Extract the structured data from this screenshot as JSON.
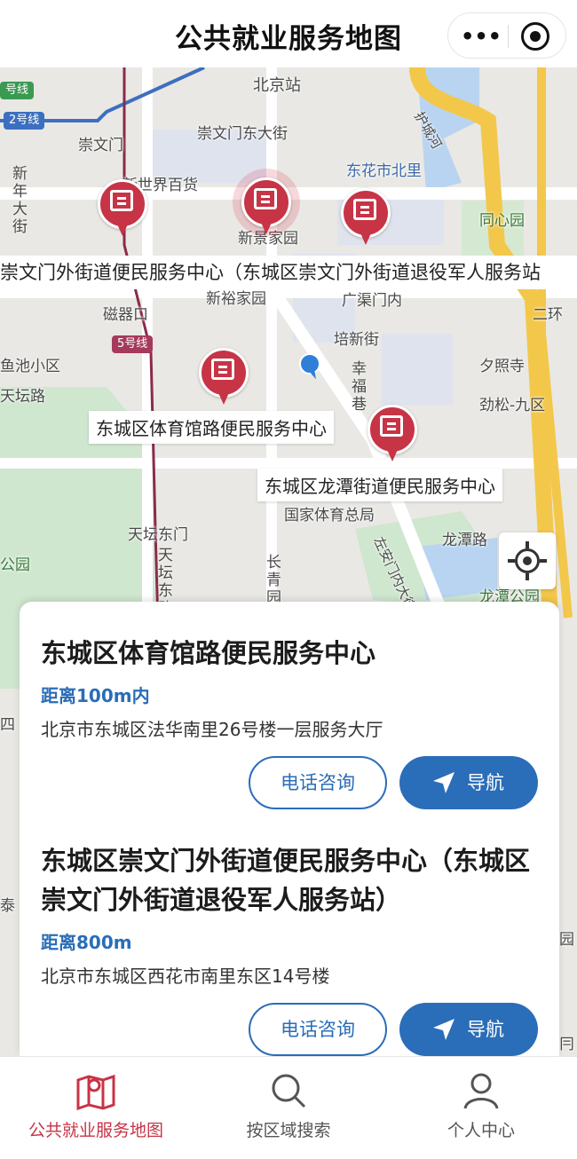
{
  "header": {
    "title": "公共就业服务地图",
    "more_icon": "•••"
  },
  "map": {
    "labels": {
      "beijing_station": "北京站",
      "chongwenmen": "崇文门",
      "chongwenmen_east_st": "崇文门东大街",
      "new_world": "新世界百货",
      "donghuashi_n": "东花市北里",
      "hucheng_river": "护城河",
      "tongxinyuan": "同心园",
      "xinjing_home": "新景家园",
      "xinyu_home": "新裕家园",
      "guangqumen_nei": "广渠门内",
      "ciqikou": "磁器口",
      "peixin_st": "培新街",
      "xingfu_lane": "幸福巷",
      "xizhaosi": "夕照寺",
      "jinsong9": "劲松-九区",
      "yuchi_district": "鱼池小区",
      "tiantan_road": "天坛路",
      "tiantan_east_gate": "天坛东门",
      "tiantan_east_road": "天坛东路",
      "changqingyuan": "长青园",
      "national_sports": "国家体育总局",
      "longtan_road": "龙潭路",
      "zuoanmen": "左安门内大街",
      "longtan_park": "龙潭公园",
      "park": "公园",
      "huan": "二环",
      "xin_nian_da_jie": "新年大街",
      "line_2": "2号线",
      "line_5": "5号线",
      "line_hao": "号线",
      "right_edge_1": "园",
      "right_edge_2": "冃",
      "left_edge_si": "四",
      "left_edge_tai": "泰"
    },
    "banner": "崇文门外街道便民服务中心（东城区崇文门外街道退役军人服务站",
    "callouts": {
      "tiyuguan": "东城区体育馆路便民服务中心",
      "longtan": "东城区龙潭街道便民服务中心"
    }
  },
  "results": [
    {
      "name": "东城区体育馆路便民服务中心",
      "distance": "距离100m内",
      "address": "北京市东城区法华南里26号楼一层服务大厅",
      "phone_label": "电话咨询",
      "nav_label": "导航"
    },
    {
      "name": "东城区崇文门外街道便民服务中心（东城区崇文门外街道退役军人服务站）",
      "distance": "距离800m",
      "address": "北京市东城区西花市南里东区14号楼",
      "phone_label": "电话咨询",
      "nav_label": "导航"
    }
  ],
  "tabs": [
    {
      "label": "公共就业服务地图",
      "icon": "map-pin-icon",
      "active": true
    },
    {
      "label": "按区域搜索",
      "icon": "search-icon",
      "active": false
    },
    {
      "label": "个人中心",
      "icon": "person-icon",
      "active": false
    }
  ],
  "colors": {
    "accent_red": "#c73446",
    "primary_blue": "#2a6db8"
  }
}
